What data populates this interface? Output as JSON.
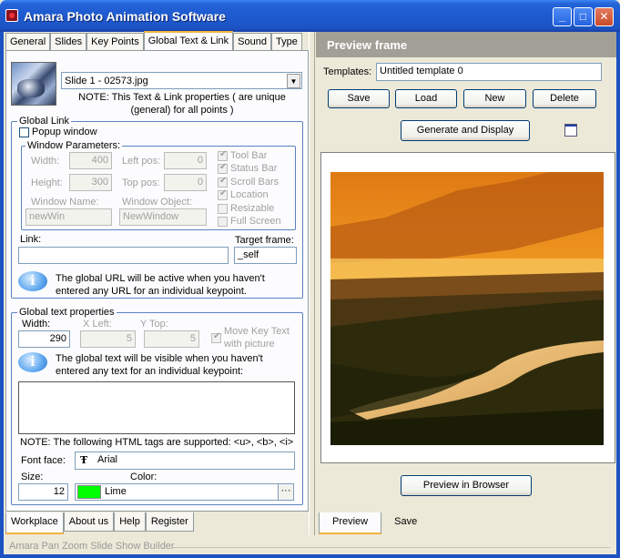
{
  "window": {
    "title": "Amara Photo Animation Software",
    "minimize": "_",
    "maximize": "□",
    "close": "✕"
  },
  "left_tabs": [
    "General",
    "Slides",
    "Key Points",
    "Global Text & Link",
    "Sound",
    "Type"
  ],
  "slide_select": {
    "value": "Slide 1 - 02573.jpg",
    "arrow": "▼"
  },
  "note_top": {
    "line1": "NOTE: This Text & Link properties ( are unique",
    "line2": "(general) for all points )"
  },
  "global_link": {
    "label": "Global Link",
    "popup_label": "Popup window",
    "window_params_label": "Window Parameters:",
    "width_label": "Width:",
    "width_value": "400",
    "height_label": "Height:",
    "height_value": "300",
    "leftpos_label": "Left pos:",
    "leftpos_value": "0",
    "toppos_label": "Top pos:",
    "toppos_value": "0",
    "winname_label": "Window Name:",
    "winname_value": "newWin",
    "winobj_label": "Window Object:",
    "winobj_value": "NewWindow",
    "toolbar_label": "Tool Bar",
    "statusbar_label": "Status Bar",
    "scrollbars_label": "Scroll Bars",
    "location_label": "Location",
    "resizable_label": "Resizable",
    "fullscreen_label": "Full Screen",
    "link_label": "Link:",
    "link_value": "",
    "target_label": "Target frame:",
    "target_value": "_self",
    "info_line1": "The global URL will be active when you haven't",
    "info_line2": "entered any URL for an individual keypoint."
  },
  "global_text": {
    "label": "Global text properties",
    "width_label": "Width:",
    "width_value": "290",
    "xleft_label": "X Left:",
    "xleft_value": "5",
    "ytop_label": "Y Top:",
    "ytop_value": "5",
    "move_label1": "Move Key Text",
    "move_label2": "with picture",
    "info_line1": "The global text will be visible when you haven't",
    "info_line2": "entered any text for an individual keypoint:",
    "text_value": "",
    "html_note": "NOTE: The following HTML tags are supported: <u>, <b>, <i>",
    "fontface_label": "Font face:",
    "fontface_value": "Arial",
    "size_label": "Size:",
    "size_value": "12",
    "color_label": "Color:",
    "color_value": "Lime",
    "color_hex": "#00ff00",
    "ellipsis": "···"
  },
  "bottom_left_tabs": [
    "Workplace",
    "About us",
    "Help",
    "Register"
  ],
  "status_text": "Amara Pan Zoom Slide Show Builder",
  "preview": {
    "header": "Preview frame",
    "templates_label": "Templates:",
    "templates_value": "Untitled template 0",
    "save_label": "Save",
    "load_label": "Load",
    "new_label": "New",
    "delete_label": "Delete",
    "generate_label": "Generate and Display",
    "preview_browser_label": "Preview in Browser"
  },
  "bottom_right_tabs": [
    "Preview",
    "Save"
  ],
  "colors": {
    "title_bar": "#1c53c3",
    "panel_header": "#a19f96",
    "tab_highlight": "#f2b43d",
    "window_bg": "#ece9d8"
  }
}
